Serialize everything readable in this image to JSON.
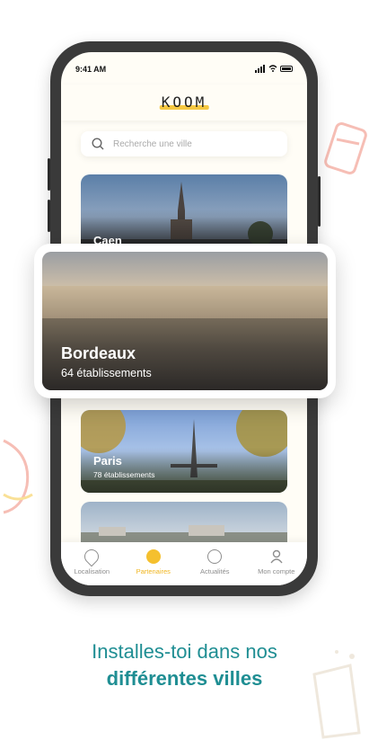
{
  "status_bar": {
    "time": "9:41 AM"
  },
  "app": {
    "logo_text": "KOOM"
  },
  "search": {
    "placeholder": "Recherche une ville"
  },
  "cities": [
    {
      "name": "Caen",
      "count": ""
    },
    {
      "name": "Bordeaux",
      "count": "64 établissements"
    },
    {
      "name": "Paris",
      "count": "78 établissements"
    },
    {
      "name": "",
      "count": ""
    }
  ],
  "bottom_nav": [
    {
      "label": "Localisation",
      "icon": "location-icon",
      "active": false
    },
    {
      "label": "Partenaires",
      "icon": "partners-icon",
      "active": true
    },
    {
      "label": "Actualités",
      "icon": "compass-icon",
      "active": false
    },
    {
      "label": "Mon compte",
      "icon": "user-icon",
      "active": false
    }
  ],
  "tagline": {
    "line1": "Installes-toi dans nos",
    "line2": "différentes villes"
  },
  "colors": {
    "accent": "#f5c02e",
    "teal": "#1f8e93"
  }
}
